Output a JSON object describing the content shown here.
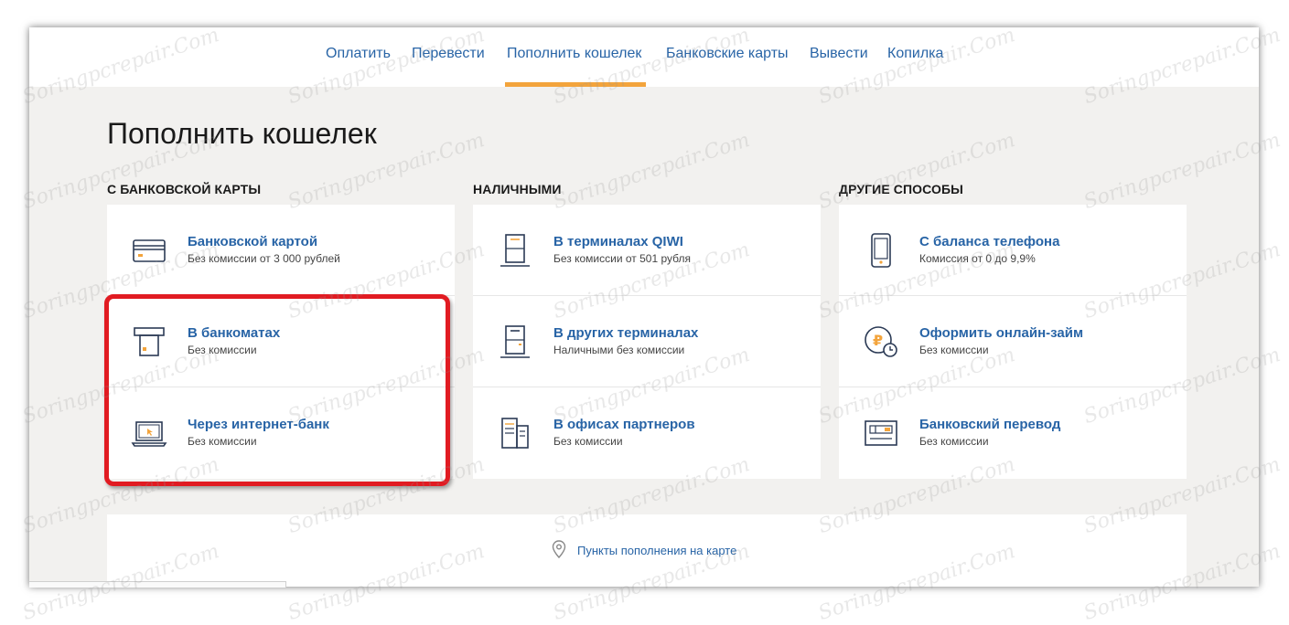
{
  "nav": {
    "tabs": [
      {
        "label": "Оплатить"
      },
      {
        "label": "Перевести"
      },
      {
        "label": "Пополнить кошелек"
      },
      {
        "label": "Банковские карты"
      },
      {
        "label": "Вывести"
      },
      {
        "label": "Копилка"
      }
    ],
    "active_index": 2
  },
  "page": {
    "title": "Пополнить кошелек"
  },
  "columns": [
    {
      "title": "С БАНКОВСКОЙ КАРТЫ",
      "items": [
        {
          "title": "Банковской картой",
          "subtitle": "Без комиссии от 3 000 рублей",
          "icon": "bank-card-icon"
        },
        {
          "title": "В банкоматах",
          "subtitle": "Без комиссии",
          "icon": "atm-icon"
        },
        {
          "title": "Через интернет-банк",
          "subtitle": "Без комиссии",
          "icon": "laptop-icon"
        }
      ]
    },
    {
      "title": "НАЛИЧНЫМИ",
      "items": [
        {
          "title": "В терминалах QIWI",
          "subtitle": "Без комиссии от 501 рубля",
          "icon": "qiwi-terminal-icon"
        },
        {
          "title": "В других терминалах",
          "subtitle": "Наличными без комиссии",
          "icon": "terminal-icon"
        },
        {
          "title": "В офисах партнеров",
          "subtitle": "Без комиссии",
          "icon": "office-building-icon"
        }
      ]
    },
    {
      "title": "ДРУГИЕ СПОСОБЫ",
      "items": [
        {
          "title": "С баланса телефона",
          "subtitle": "Комиссия от 0 до 9,9%",
          "icon": "phone-icon"
        },
        {
          "title": "Оформить онлайн-займ",
          "subtitle": "Без комиссии",
          "icon": "ruble-clock-icon"
        },
        {
          "title": "Банковский перевод",
          "subtitle": "Без комиссии",
          "icon": "bank-transfer-icon"
        }
      ]
    }
  ],
  "map_link": {
    "label": "Пункты пополнения на карте",
    "icon": "location-pin-icon"
  },
  "watermark": "Soringpcrepair.Com",
  "colors": {
    "accent": "#f3a43c",
    "link": "#2864a6",
    "highlight": "#e11b22"
  }
}
